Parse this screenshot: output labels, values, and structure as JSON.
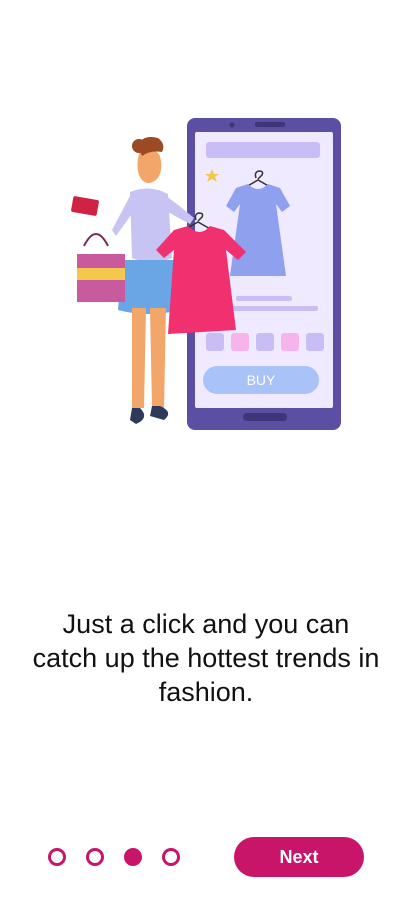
{
  "onboarding": {
    "illustration": {
      "buy_label": "BUY"
    },
    "caption": "Just a click and you can catch up the hottest trends in fashion.",
    "pager": {
      "total": 4,
      "active_index": 2
    },
    "next_label": "Next"
  },
  "colors": {
    "accent": "#c8156a",
    "phone_frame": "#5b4fa3",
    "phone_screen": "#efeaff",
    "dress_pink": "#f0306f",
    "dress_blue": "#8fa0ee"
  }
}
